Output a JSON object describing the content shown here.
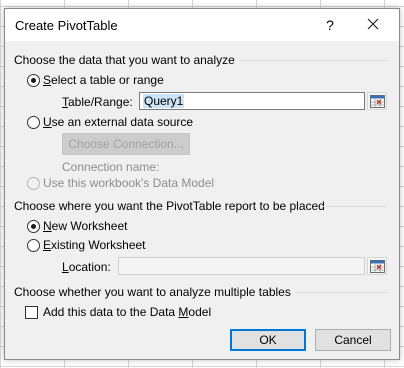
{
  "dialog": {
    "title": "Create PivotTable",
    "help_label": "?",
    "close_icon": "close-icon"
  },
  "section_data": {
    "heading": "Choose the data that you want to analyze",
    "option_table_range": {
      "label_first": "S",
      "label_rest": "elect a table or range",
      "selected": true
    },
    "table_range_label": "Table/Range:",
    "table_range_label_accel": "T",
    "table_range_label_rest": "able/Range:",
    "table_range_value": "Query1",
    "option_external": {
      "label_first": "U",
      "label_rest": "se an external data source",
      "selected": false
    },
    "choose_connection_button": "Choose Connection...",
    "connection_name_label": "Connection name:",
    "option_data_model": {
      "label": "Use this workbook's Data Model",
      "disabled": true
    }
  },
  "section_location": {
    "heading": "Choose where you want the PivotTable report to be placed",
    "option_new": {
      "label_first": "N",
      "label_rest": "ew Worksheet",
      "selected": true
    },
    "option_existing": {
      "label_first": "E",
      "label_rest": "xisting Worksheet",
      "selected": false
    },
    "location_label_first": "L",
    "location_label_rest": "ocation:",
    "location_value": ""
  },
  "section_multiple": {
    "heading": "Choose whether you want to analyze multiple tables",
    "add_to_model_prefix": "Add this data to the Data ",
    "add_to_model_accel": "M",
    "add_to_model_suffix": "odel",
    "add_to_model_checked": false
  },
  "buttons": {
    "ok": "OK",
    "cancel": "Cancel"
  },
  "colors": {
    "primary_border": "#0078d7",
    "dialog_bg": "#f0f0f0",
    "selection": "#cce4f7"
  }
}
